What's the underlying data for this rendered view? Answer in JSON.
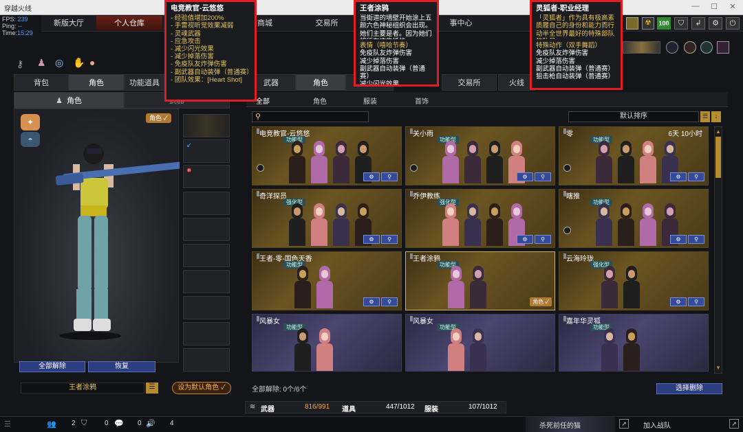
{
  "window": {
    "title": "穿越火线"
  },
  "stats": {
    "fps_label": "FPS:",
    "fps": "239",
    "ping_label": "Ping:",
    "ping": "--",
    "time_label": "Time:",
    "time": "15:29"
  },
  "topnav": [
    "新版大厅",
    "个人仓库",
    "商城",
    "交易所",
    "事中心"
  ],
  "topnav_active": 1,
  "currency": {
    "value": "100"
  },
  "left": {
    "tabs": [
      "背包",
      "角色",
      "功能道具"
    ],
    "subtabs": [
      "角色",
      "武器"
    ],
    "role_badge": "角色 ✓",
    "unequip_all": "全部解除",
    "restore": "恢复",
    "character_name": "王者涂鸦",
    "set_default": "设为默认角色 ✓"
  },
  "main": {
    "tabs": [
      "武器",
      "角色",
      "服装",
      "交易所",
      "火线"
    ],
    "subtabs": [
      "全部",
      "角色",
      "服装",
      "首饰"
    ],
    "sort": "默认排序",
    "search_placeholder": ""
  },
  "cards": [
    {
      "name": "电竞教官-云悠悠",
      "badge": "功能型",
      "time": "",
      "style": "gold"
    },
    {
      "name": "关小雨",
      "badge": "功能型",
      "time": "",
      "style": "gold"
    },
    {
      "name": "零",
      "badge": "功能型",
      "time": "6天 10小时",
      "style": "gold"
    },
    {
      "name": "奇洋探员",
      "badge": "强化型",
      "time": "",
      "style": "gold"
    },
    {
      "name": "乔伊教练",
      "badge": "强化型",
      "time": "",
      "style": "gold"
    },
    {
      "name": "瞎推",
      "badge": "功能型",
      "time": "",
      "style": "gold"
    },
    {
      "name": "王者-零-国色天香",
      "badge": "功能型",
      "time": "",
      "style": "gold"
    },
    {
      "name": "王者涂鸦",
      "badge": "功能型",
      "time": "",
      "style": "gold",
      "equipped": "角色 ✓"
    },
    {
      "name": "云海玲珑",
      "badge": "强化型",
      "time": "",
      "style": "gold"
    },
    {
      "name": "风暴女",
      "badge": "功能型",
      "time": "",
      "style": "purple"
    },
    {
      "name": "风暴女",
      "badge": "功能型",
      "time": "",
      "style": "purple"
    },
    {
      "name": "嘉年华灵狐",
      "badge": "功能型",
      "time": "",
      "style": "purple"
    }
  ],
  "footer": {
    "unequip_count": "全部解除: 0个/6个",
    "select_remove": "选择删除",
    "weapons_label": "武器",
    "weapons_count": "816/991",
    "items_label": "道具",
    "items_count": "447/1012",
    "clothes_label": "服装",
    "clothes_count": "107/1012"
  },
  "bottombar": {
    "v1": "2",
    "v2": "0",
    "v3": "0",
    "v4": "4",
    "friend": "杀死前任的猫",
    "join": "加入战队"
  },
  "tooltips": [
    {
      "title": "电竞教官-云悠悠",
      "lines": [
        "- 经验值增加200%",
        "- 手雷视听觉效果减弱",
        "- 灵魂武器",
        "- 应急攻击",
        "- 减少闪光效果",
        "- 减少掉落伤害",
        "- 免疫队友炸弹伤害",
        "- 副武器自动装弹（普通赛）",
        "- 团队效果：[Heart Shot]"
      ]
    },
    {
      "title": "王者涂鸦",
      "desc": "当街道的墙壁开始涂上五颜六色神秘组织会出现。她们主要是者。因为她们将所有这些抵抗",
      "lines": [
        "表情（嘻哈节奏）",
        "免疫队友炸弹伤害",
        "减少掉落伤害",
        "副武器自动装弹（普通赛）",
        "减少闪光效果"
      ]
    },
    {
      "title": "灵狐者-职业经理",
      "desc": "「灵狐者」作为具有极高素质履自己的身份和能力而行动半全世界最好的特殊部队的队员",
      "lines": [
        "特殊动作（双手舞蹈）",
        "免疫队友炸弹伤害",
        "减少掉落伤害",
        "副武器自动装弹（普通赛）",
        "狙击枪自动装弹（普通赛）"
      ]
    }
  ],
  "colors": {
    "accent_red": "#e21e25",
    "gold": "#e6c35a",
    "blue_btn": "#354a9a"
  }
}
